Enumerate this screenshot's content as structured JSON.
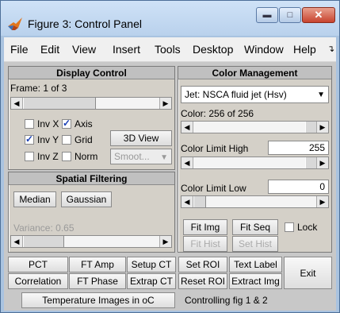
{
  "window": {
    "title": "Figure 3: Control Panel"
  },
  "menu": [
    "File",
    "Edit",
    "View",
    "Insert",
    "Tools",
    "Desktop",
    "Window",
    "Help"
  ],
  "display_control": {
    "title": "Display Control",
    "frame_label": "Frame: 1 of 3",
    "checkboxes": [
      {
        "label": "Inv X",
        "checked": false
      },
      {
        "label": "Axis",
        "checked": true
      },
      {
        "label": "Inv Y",
        "checked": true
      },
      {
        "label": "Grid",
        "checked": false
      },
      {
        "label": "Inv Z",
        "checked": false
      },
      {
        "label": "Norm",
        "checked": false
      }
    ],
    "view3d_button": "3D View",
    "shading_dropdown": "Smoot..."
  },
  "spatial_filtering": {
    "title": "Spatial Filtering",
    "median_button": "Median",
    "gaussian_button": "Gaussian",
    "variance_label": "Variance: 0.65"
  },
  "color_management": {
    "title": "Color Management",
    "colormap_dropdown": "Jet: NSCA fluid jet (Hsv)",
    "color_count_label": "Color: 256 of 256",
    "limit_high_label": "Color Limit High",
    "limit_high_value": "255",
    "limit_low_label": "Color Limit Low",
    "limit_low_value": "0",
    "fit_img_button": "Fit Img",
    "fit_seq_button": "Fit Seq",
    "lock_label": "Lock",
    "fit_hist_button": "Fit Hist",
    "set_hist_button": "Set Hist"
  },
  "bottom_buttons": {
    "pct": "PCT",
    "ft_amp": "FT Amp",
    "setup_ct": "Setup CT",
    "set_roi": "Set ROI",
    "text_label": "Text Label",
    "exit": "Exit",
    "correlation": "Correlation",
    "ft_phase": "FT Phase",
    "extrap_ct": "Extrap CT",
    "reset_roi": "Reset ROI",
    "extract_img": "Extract Img",
    "temperature_images": "Temperature Images in oC",
    "status_text": "Controlling fig 1 & 2"
  }
}
